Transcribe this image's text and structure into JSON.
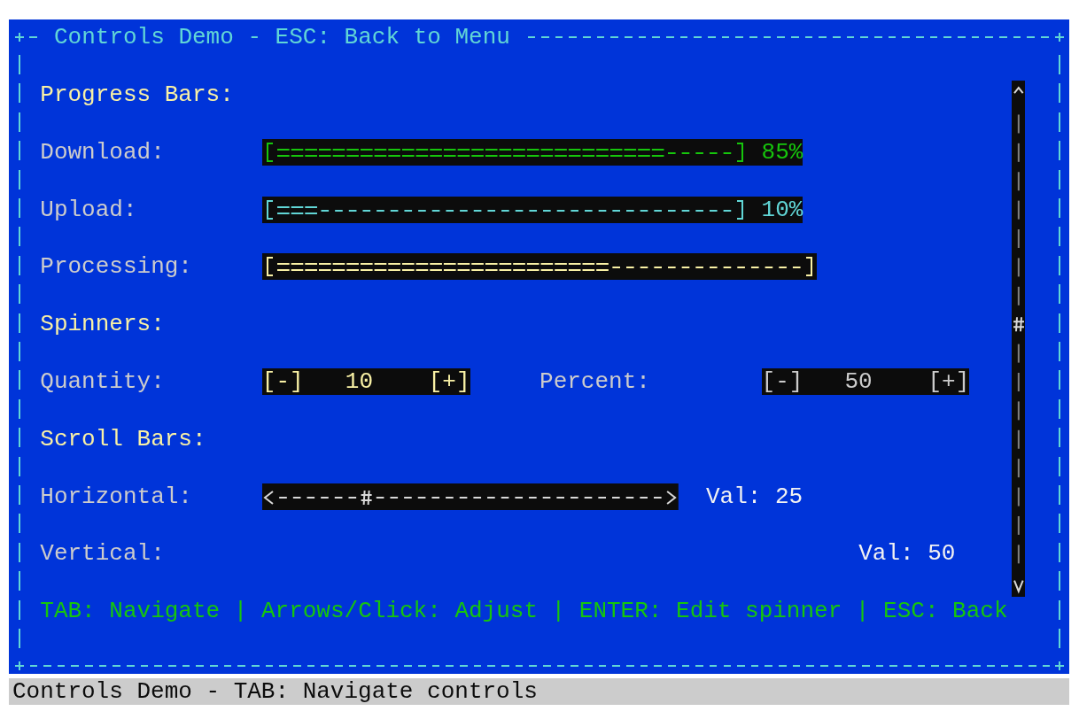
{
  "window": {
    "title": "Controls Demo - ESC: Back to Menu"
  },
  "sections": [
    {
      "heading": "Progress Bars:",
      "rows": [
        {
          "kind": "progress",
          "label": "Download:",
          "level": 0.85,
          "reading": "85%",
          "color": "#16c60c"
        },
        {
          "kind": "progress",
          "label": "Upload:",
          "level": 0.1,
          "reading": "10%",
          "color": "#61d6d6"
        },
        {
          "kind": "progress",
          "label": "Processing:",
          "level": 0.63,
          "color": "#f9f1a5"
        }
      ]
    },
    {
      "heading": "Spinners:",
      "rows": [
        {
          "kind": "spinners",
          "label": "Quantity:",
          "spinners": [
            {
              "value": "10",
              "selected": true,
              "decrement": "[-]",
              "increment": "[+]"
            },
            {
              "label": "Percent:",
              "value": "50",
              "selected": false,
              "decrement": "[-]",
              "increment": "[+]"
            }
          ]
        }
      ]
    },
    {
      "heading": "Scroll Bars:",
      "rows": [
        {
          "kind": "hscroll",
          "label": "Horizontal:",
          "level": 0.25,
          "reading": "Val: 25"
        },
        {
          "kind": "vscroll",
          "label": "Vertical:",
          "level": 0.5,
          "reading": "Val: 50"
        }
      ]
    }
  ],
  "help": "TAB: Navigate | Arrows/Click: Adjust | ENTER: Edit spinner | ESC: Back",
  "status_bar": "Controls Demo - TAB: Navigate controls"
}
